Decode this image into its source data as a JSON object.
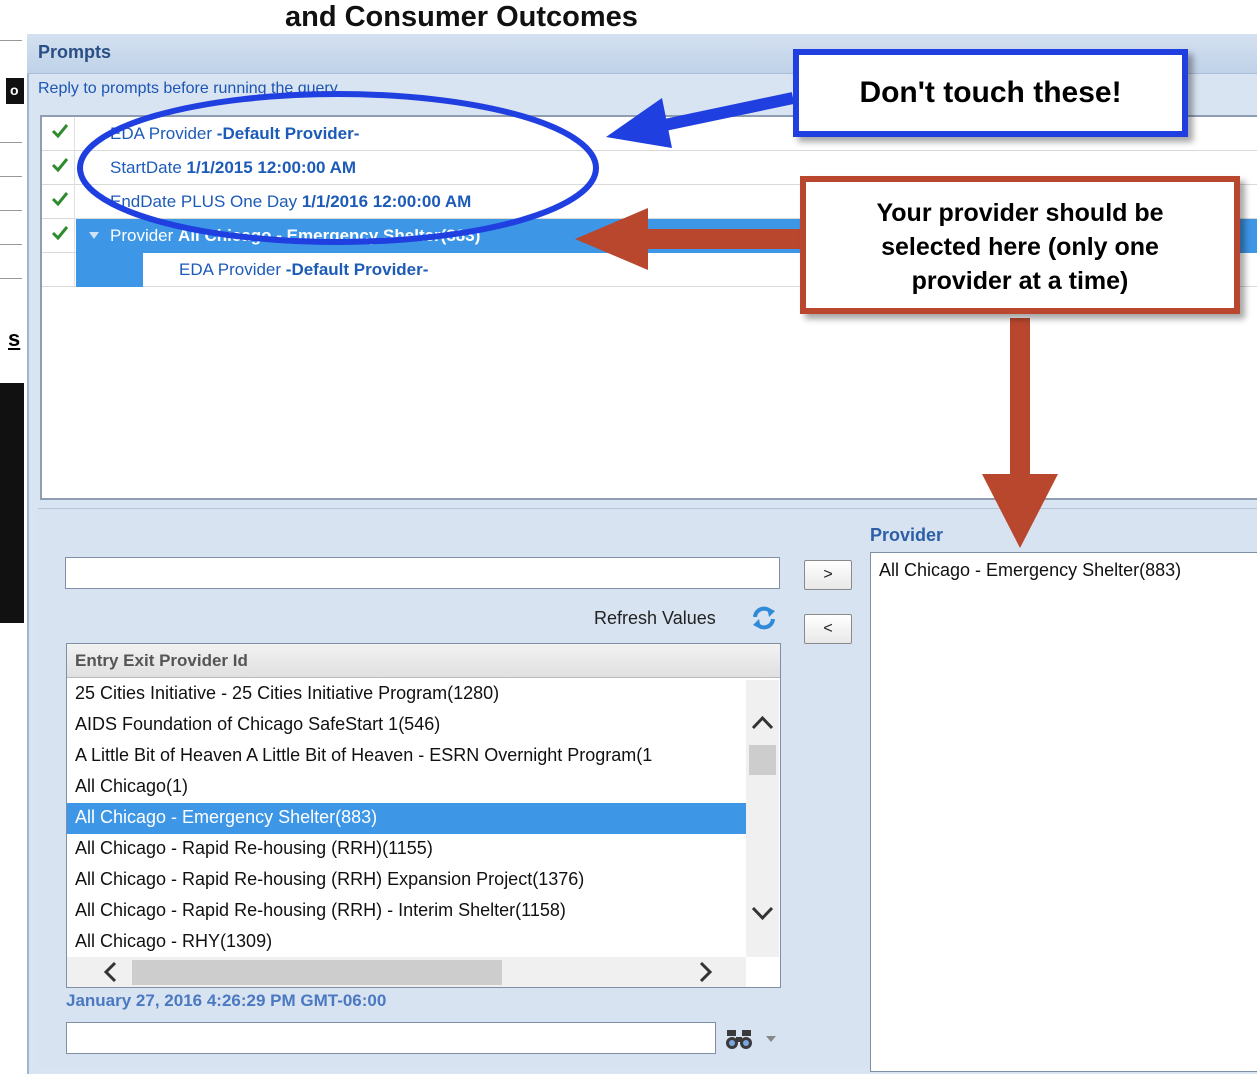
{
  "background": {
    "title_fragment": "and Consumer Outcomes",
    "left_fragment_a": "o",
    "left_fragment_b": "s"
  },
  "dialog": {
    "title": "Prompts",
    "subtitle": "Reply to prompts before running the query."
  },
  "prompts": [
    {
      "name": "EDA Provider",
      "value": "-Default Provider-",
      "status": "check-icon"
    },
    {
      "name": "StartDate",
      "value": "1/1/2015 12:00:00 AM",
      "status": "check-icon"
    },
    {
      "name": "EndDate PLUS One Day",
      "value": "1/1/2016 12:00:00 AM",
      "status": "check-icon"
    },
    {
      "name": "Provider",
      "value": "All Chicago - Emergency Shelter(883)",
      "status": "check-icon"
    },
    {
      "name": "EDA Provider",
      "value": "-Default Provider-"
    }
  ],
  "search": {
    "value": ""
  },
  "buttons": {
    "add": ">",
    "remove": "<"
  },
  "refresh": {
    "label": "Refresh Values",
    "icon": "refresh-icon"
  },
  "value_list": {
    "header": "Entry Exit Provider Id",
    "items": [
      "25 Cities Initiative - 25 Cities Initiative Program(1280)",
      "AIDS Foundation of Chicago SafeStart 1(546)",
      "A Little Bit of Heaven A Little Bit of Heaven - ESRN Overnight Program(1",
      "All Chicago(1)",
      "All Chicago - Emergency Shelter(883)",
      "All Chicago - Rapid Re-housing (RRH)(1155)",
      "All Chicago - Rapid Re-housing (RRH) Expansion Project(1376)",
      "All Chicago - Rapid Re-housing (RRH) - Interim Shelter(1158)",
      "All Chicago - RHY(1309)"
    ],
    "selected_index": 4
  },
  "timestamp": "January 27, 2016 4:26:29 PM GMT-06:00",
  "selected": {
    "label": "Provider",
    "value": "All Chicago - Emergency Shelter(883)"
  },
  "annotations": {
    "blue_callout": "Don't touch these!",
    "red_callout_lines": [
      "Your provider should be",
      "selected here (only one",
      "provider at a time)"
    ],
    "blue_color": "#1f3fe0",
    "red_color": "#b9472e"
  }
}
